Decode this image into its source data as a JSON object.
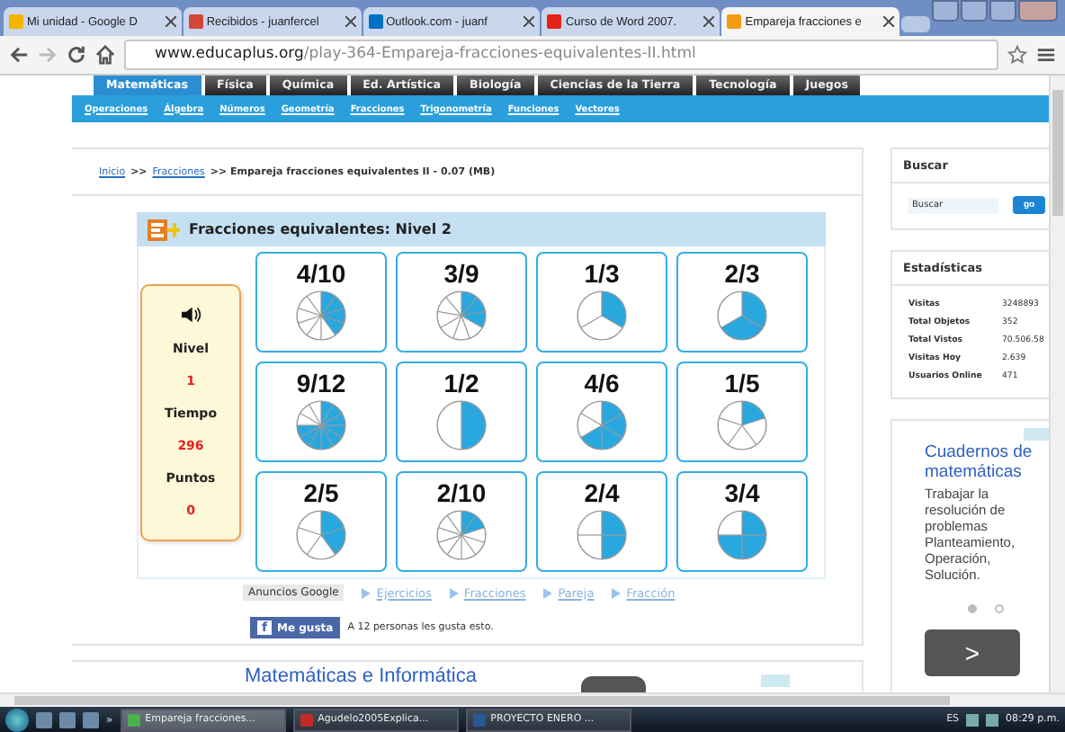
{
  "browser": {
    "tabs": [
      {
        "title": "Mi unidad - Google D",
        "selected": false
      },
      {
        "title": "Recibidos - juanfercel",
        "selected": false
      },
      {
        "title": "Outlook.com - juanf",
        "selected": false
      },
      {
        "title": "Curso de Word 2007.",
        "selected": false
      },
      {
        "title": "Empareja fracciones e",
        "selected": true
      }
    ],
    "url_host": "www.educaplus.org",
    "url_path": "/play-364-Empareja-fracciones-equivalentes-II.html"
  },
  "nav": {
    "tabs": [
      {
        "label": "Matemáticas",
        "selected": true
      },
      {
        "label": "Física",
        "selected": false
      },
      {
        "label": "Química",
        "selected": false
      },
      {
        "label": "Ed. Artística",
        "selected": false
      },
      {
        "label": "Biología",
        "selected": false
      },
      {
        "label": "Ciencias de la Tierra",
        "selected": false
      },
      {
        "label": "Tecnología",
        "selected": false
      },
      {
        "label": "Juegos",
        "selected": false
      }
    ],
    "sub_links": [
      "Operaciones",
      "Álgebra",
      "Números",
      "Geometría",
      "Fracciones",
      "Trigonometría",
      "Funciones",
      "Vectores"
    ]
  },
  "breadcrumb": [
    {
      "text": "Inicio",
      "kind": "link"
    },
    {
      "text": ">>",
      "kind": "text"
    },
    {
      "text": "Fracciones",
      "kind": "link"
    },
    {
      "text": ">> Empareja fracciones equivalentes II - 0.07 (MB)",
      "kind": "text"
    }
  ],
  "game": {
    "title": "Fracciones equivalentes: Nivel 2",
    "stats": [
      {
        "label": "Nivel",
        "value": "1"
      },
      {
        "label": "Tiempo",
        "value": "296"
      },
      {
        "label": "Puntos",
        "value": "0"
      }
    ],
    "cards": [
      {
        "fraction": "4/10"
      },
      {
        "fraction": "3/9"
      },
      {
        "fraction": "1/3"
      },
      {
        "fraction": "2/3"
      },
      {
        "fraction": "9/12"
      },
      {
        "fraction": "1/2"
      },
      {
        "fraction": "4/6"
      },
      {
        "fraction": "1/5"
      },
      {
        "fraction": "2/5"
      },
      {
        "fraction": "2/10"
      },
      {
        "fraction": "2/4"
      },
      {
        "fraction": "3/4"
      }
    ]
  },
  "ads_label": "Anuncios Google",
  "ad_links": [
    "Ejercicios",
    "Fracciones",
    "Pareja",
    "Fracción"
  ],
  "like": {
    "icon": "f",
    "button": "Me gusta",
    "text": "A 12 personas les gusta esto."
  },
  "bottom_ad": {
    "title": "Matemáticas e Informática"
  },
  "sidebar": {
    "search": {
      "title": "Buscar",
      "placeholder": "Buscar",
      "button": "go"
    },
    "stats": {
      "title": "Estadísticas",
      "rows": [
        {
          "label": "Visitas",
          "value": "3248893"
        },
        {
          "label": "Total Objetos",
          "value": "352"
        },
        {
          "label": "Total Vistos",
          "value": "70.506.58"
        },
        {
          "label": "Visitas Hoy",
          "value": "2.639"
        },
        {
          "label": "Usuarios Online",
          "value": "471"
        }
      ]
    },
    "ad": {
      "title": "Cuadernos de matemáticas",
      "text": "Trabajar la resolución de problemas Planteamiento, Operación, Solución.",
      "dots": [
        {
          "selected": true
        },
        {
          "selected": false
        }
      ],
      "next": ">"
    }
  },
  "taskbar": {
    "overflow": "»",
    "tasks": [
      {
        "title": "Empareja fracciones...",
        "selected": true
      },
      {
        "title": "Agudelo2005Explica...",
        "selected": false
      },
      {
        "title": "PROYECTO ENERO ...",
        "selected": false
      }
    ],
    "language": "ES",
    "time": "08:29 p.m."
  }
}
